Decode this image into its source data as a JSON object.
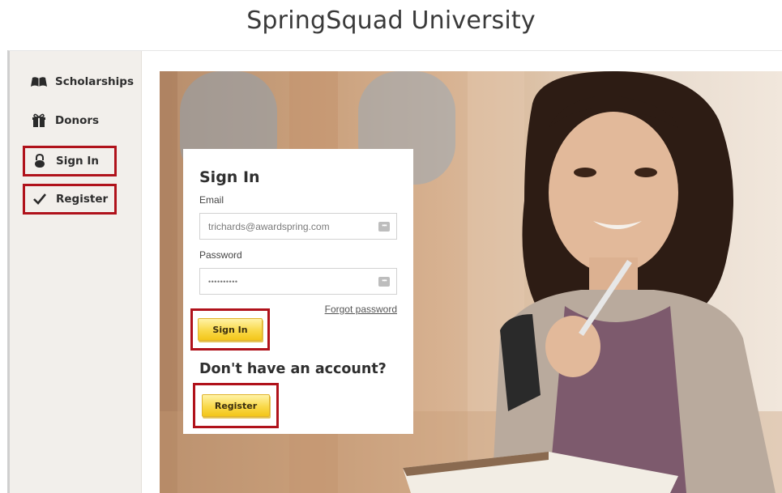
{
  "header": {
    "title": "SpringSquad University"
  },
  "sidebar": {
    "items": [
      {
        "label": "Scholarships",
        "icon": "book-icon"
      },
      {
        "label": "Donors",
        "icon": "gift-icon"
      },
      {
        "label": "Sign In",
        "icon": "lock-icon"
      },
      {
        "label": "Register",
        "icon": "checkmark-icon"
      }
    ]
  },
  "signin": {
    "title": "Sign In",
    "email_label": "Email",
    "email_value": "trichards@awardspring.com",
    "password_label": "Password",
    "password_value": "••••••••••",
    "forgot_label": "Forgot password",
    "submit_label": "Sign In",
    "no_account_text": "Don't have an account?",
    "register_label": "Register"
  },
  "colors": {
    "highlight": "#b0121b",
    "button": "#f9d94a",
    "sidebar_bg": "#f2efeb"
  }
}
